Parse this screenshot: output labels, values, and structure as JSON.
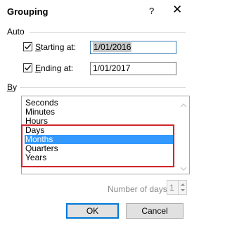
{
  "dialog": {
    "title": "Grouping",
    "help_label": "?",
    "close_label": "✕"
  },
  "auto": {
    "label": "Auto",
    "starting": {
      "label_underlined": "S",
      "label_rest": "tarting at:",
      "checked": true,
      "value": "1/01/2016"
    },
    "ending": {
      "label_underlined": "E",
      "label_rest": "nding at:",
      "checked": true,
      "value": "1/01/2017"
    }
  },
  "by": {
    "label_underlined": "B",
    "label_rest": "y",
    "items": [
      {
        "label": "Seconds",
        "selected": false
      },
      {
        "label": "Minutes",
        "selected": false
      },
      {
        "label": "Hours",
        "selected": false
      },
      {
        "label": "Days",
        "selected": false
      },
      {
        "label": "Months",
        "selected": true
      },
      {
        "label": "Quarters",
        "selected": false
      },
      {
        "label": "Years",
        "selected": false
      }
    ]
  },
  "number_of_days": {
    "label": "Number of days:",
    "value": "1"
  },
  "buttons": {
    "ok": "OK",
    "cancel": "Cancel"
  },
  "colors": {
    "selection": "#3399ff",
    "highlight_box": "#d2232a",
    "focus_border": "#0078d7"
  }
}
